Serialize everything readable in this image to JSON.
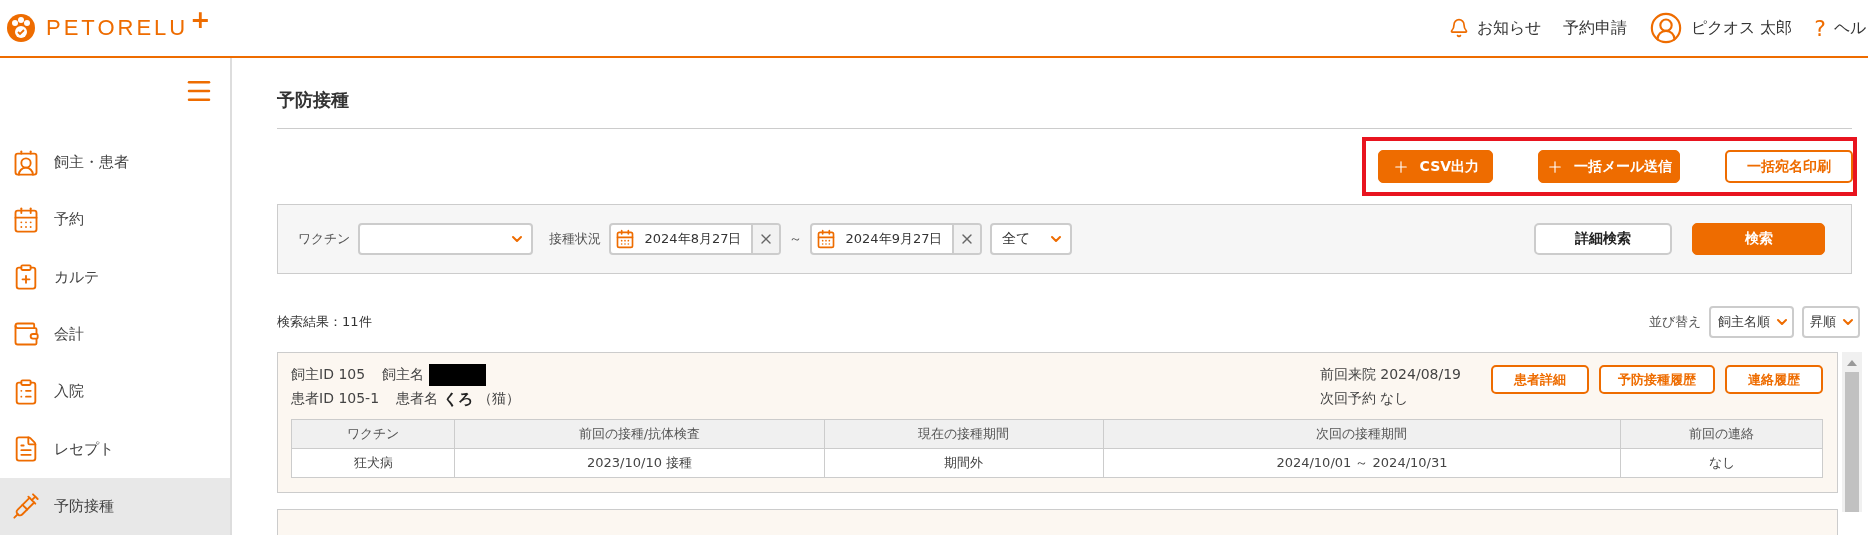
{
  "header": {
    "logo": "PETORELU",
    "logo_mark": "+",
    "links": [
      {
        "label": "お知らせ"
      },
      {
        "label": "予約申請"
      }
    ],
    "user": "ピクオス 太郎",
    "help_mark": "?",
    "help": "ヘル"
  },
  "sidebar": {
    "items": [
      {
        "label": "飼主・患者",
        "selected": false
      },
      {
        "label": "予約",
        "selected": false
      },
      {
        "label": "カルテ",
        "selected": false
      },
      {
        "label": "会計",
        "selected": false
      },
      {
        "label": "入院",
        "selected": false
      },
      {
        "label": "レセプト",
        "selected": false
      },
      {
        "label": "予防接種",
        "selected": true
      }
    ]
  },
  "page": {
    "title": "予防接種"
  },
  "actions": [
    {
      "label": "CSV出力",
      "kind": "filled"
    },
    {
      "label": "一括メール送信",
      "kind": "filled"
    },
    {
      "label": "一括宛名印刷",
      "kind": "outline"
    }
  ],
  "filters": {
    "vaccine_label": "ワクチン",
    "status_label": "接種状況",
    "date_from": "2024年8月27日",
    "range_sep": "～",
    "date_to": "2024年9月27日",
    "status_value": "全て",
    "detail_button": "詳細検索",
    "search_button": "検索"
  },
  "results": {
    "count": "検索結果：11件",
    "sort_label": "並び替え",
    "sort_by": "飼主名順",
    "order": "昇順"
  },
  "cards": [
    {
      "owner_id_label": "飼主ID",
      "owner_id": "105",
      "owner_name_label": "飼主名",
      "patient_id_label": "患者ID",
      "patient_id": "105-1",
      "patient_name_label": "患者名",
      "patient_name": "くろ",
      "species": "（猫）",
      "last_visit_label": "前回来院",
      "last_visit": "2024/08/19",
      "next_label": "次回予約",
      "next_value": "なし",
      "buttons": [
        "患者詳細",
        "予防接種履歴",
        "連絡履歴"
      ],
      "columns": [
        "ワクチン",
        "前回の接種/抗体検査",
        "現在の接種期間",
        "次回の接種期間",
        "前回の連絡"
      ],
      "rows": [
        [
          "狂犬病",
          "2023/10/10 接種",
          "期間外",
          "2024/10/01 ～ 2024/10/31",
          "なし"
        ]
      ]
    }
  ]
}
